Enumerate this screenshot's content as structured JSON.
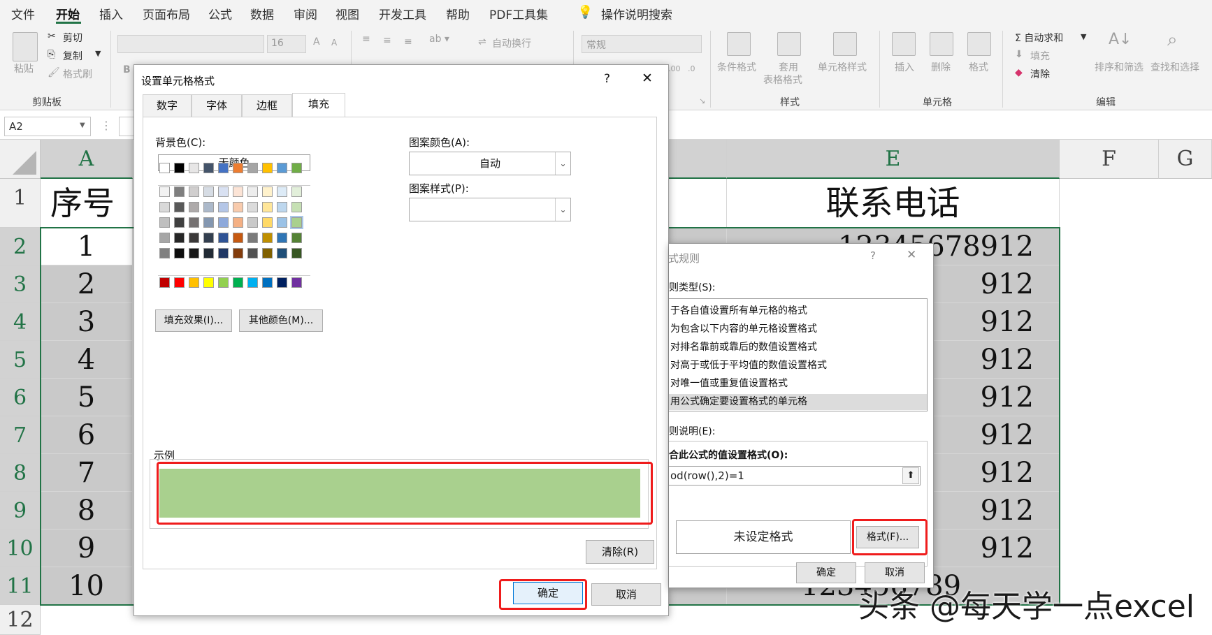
{
  "menubar": {
    "tabs": [
      "文件",
      "开始",
      "插入",
      "页面布局",
      "公式",
      "数据",
      "审阅",
      "视图",
      "开发工具",
      "帮助",
      "PDF工具集"
    ],
    "search": "操作说明搜索"
  },
  "ribbon": {
    "clipboard": {
      "paste": "粘贴",
      "cut": "剪切",
      "copy": "复制",
      "format_painter": "格式刷",
      "group": "剪贴板"
    },
    "font": {
      "size": "16",
      "bold": "B"
    },
    "alignment": {
      "wrap_text": "自动换行"
    },
    "number": {
      "format": "常规",
      "dec_inc": ".00",
      "dec_dec": ".0"
    },
    "styles": {
      "conditional": "条件格式",
      "table_1": "套用",
      "table_2": "表格格式",
      "cell_styles": "单元格样式",
      "group": "样式"
    },
    "cells": {
      "insert": "插入",
      "delete": "删除",
      "format": "格式",
      "group": "单元格"
    },
    "editing": {
      "autosum": "Σ 自动求和",
      "fill": "填充",
      "clear": "清除",
      "sort": "排序和筛选",
      "find": "查找和选择",
      "group": "编辑"
    }
  },
  "formula_bar": {
    "name_box": "A2"
  },
  "grid": {
    "columns": [
      "A",
      "E",
      "F",
      "G"
    ],
    "rows": [
      "1",
      "2",
      "3",
      "4",
      "5",
      "6",
      "7",
      "8",
      "9",
      "10",
      "11",
      "12"
    ],
    "header_a": "序号",
    "header_e": "联系电话",
    "numbers": [
      "1",
      "2",
      "3",
      "4",
      "5",
      "6",
      "7",
      "8",
      "9",
      "10"
    ],
    "phone_first": "12345678912",
    "phone_tail": "912",
    "phone_last": "123456789"
  },
  "format_dialog": {
    "title": "设置单元格格式",
    "help": "?",
    "close": "✕",
    "tabs": [
      "数字",
      "字体",
      "边框",
      "填充"
    ],
    "background_label": "背景色(C):",
    "no_color": "无颜色",
    "fill_effects": "填充效果(I)...",
    "more_colors": "其他颜色(M)...",
    "pattern_color_label": "图案颜色(A):",
    "pattern_color_value": "自动",
    "pattern_style_label": "图案样式(P):",
    "sample_label": "示例",
    "sample_color": "#a9d08e",
    "clear": "清除(R)",
    "ok": "确定",
    "cancel": "取消"
  },
  "rule_dialog": {
    "title": "式规则",
    "help": "?",
    "close": "✕",
    "rule_type_label": "则类型(S):",
    "rule_types": [
      "于各自值设置所有单元格的格式",
      "为包含以下内容的单元格设置格式",
      "对排名靠前或靠后的数值设置格式",
      "对高于或低于平均值的数值设置格式",
      "对唯一值或重复值设置格式",
      "用公式确定要设置格式的单元格"
    ],
    "rule_desc_label": "则说明(E):",
    "formula_label": "合此公式的值设置格式(O):",
    "formula": "od(row(),2)=1",
    "preview": "未设定格式",
    "format_button": "格式(F)...",
    "ok": "确定",
    "cancel": "取消"
  },
  "watermark": "头条 @每天学一点excel"
}
